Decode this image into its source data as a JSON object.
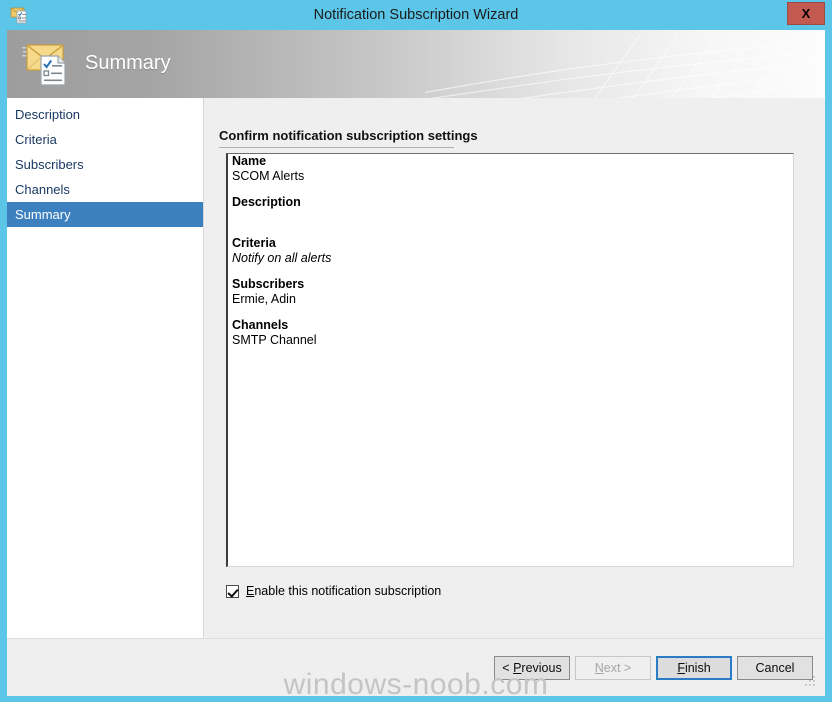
{
  "window": {
    "title": "Notification Subscription Wizard",
    "close_label": "X",
    "title_icon": "envelope-checklist-icon"
  },
  "banner": {
    "title": "Summary",
    "icon": "envelope-checklist-icon"
  },
  "sidebar": {
    "items": [
      {
        "label": "Description",
        "selected": false
      },
      {
        "label": "Criteria",
        "selected": false
      },
      {
        "label": "Subscribers",
        "selected": false
      },
      {
        "label": "Channels",
        "selected": false
      },
      {
        "label": "Summary",
        "selected": true
      }
    ]
  },
  "content": {
    "heading": "Confirm notification subscription settings",
    "summary": [
      {
        "label": "Name",
        "value": "SCOM Alerts",
        "italic": false
      },
      {
        "label": "Description",
        "value": "",
        "italic": false
      },
      {
        "label": "Criteria",
        "value": "Notify on all alerts",
        "italic": true
      },
      {
        "label": "Subscribers",
        "value": "Ermie, Adin",
        "italic": false
      },
      {
        "label": "Channels",
        "value": "SMTP Channel",
        "italic": false
      }
    ],
    "enable_checkbox": {
      "checked": true,
      "accelerator": "E",
      "label_rest": "nable this notification subscription"
    }
  },
  "footer": {
    "buttons": [
      {
        "id": "previous",
        "prefix": "< ",
        "accelerator": "P",
        "suffix": "revious",
        "state": "enabled"
      },
      {
        "id": "next",
        "prefix": "",
        "accelerator": "N",
        "suffix": "ext >",
        "state": "disabled"
      },
      {
        "id": "finish",
        "prefix": "",
        "accelerator": "F",
        "suffix": "inish",
        "state": "default"
      },
      {
        "id": "cancel",
        "prefix": "",
        "accelerator": "",
        "suffix": "Cancel",
        "state": "enabled"
      }
    ]
  },
  "watermark": {
    "text": "windows-noob.com"
  },
  "colors": {
    "title_bar": "#5bc6e8",
    "close_button": "#c35a52",
    "sidebar_selected": "#3c80c0",
    "sidebar_text": "#1b3a63",
    "content_background": "#efefef",
    "panel_background": "#ffffff",
    "default_button_focus": "#2a7dc4",
    "watermark": "#c4c4c4"
  }
}
